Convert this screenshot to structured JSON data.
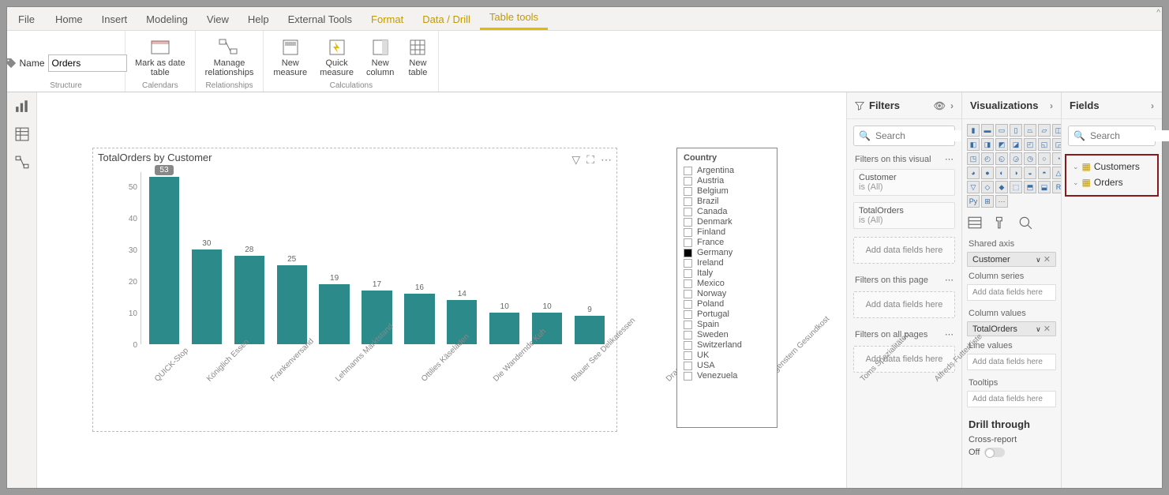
{
  "menu": {
    "file": "File",
    "tabs": [
      "Home",
      "Insert",
      "Modeling",
      "View",
      "Help",
      "External Tools",
      "Format",
      "Data / Drill",
      "Table tools"
    ]
  },
  "ribbon": {
    "name_label": "Name",
    "name_value": "Orders",
    "structure_group": "Structure",
    "calendars_group": "Calendars",
    "relationships_group": "Relationships",
    "calculations_group": "Calculations",
    "mark_date": "Mark as date\ntable",
    "manage_rel": "Manage\nrelationships",
    "new_measure": "New\nmeasure",
    "quick_measure": "Quick\nmeasure",
    "new_column": "New\ncolumn",
    "new_table": "New\ntable"
  },
  "chart_data": {
    "type": "bar",
    "title": "TotalOrders by Customer",
    "ylim": [
      0,
      55
    ],
    "yticks": [
      0,
      10,
      20,
      30,
      40,
      50
    ],
    "categories": [
      "QUICK-Stop",
      "Königlich Essen",
      "Frankenversand",
      "Lehmanns Marktstand",
      "Ottilies Käseladen",
      "Die Wandernde Kuh",
      "Blauer See Delikatessen",
      "Drachenblut Delikatessen",
      "Morgenstern Gesundkost",
      "Toms Spezialitäten",
      "Alfreds Futterkiste"
    ],
    "values": [
      53,
      30,
      28,
      25,
      19,
      17,
      16,
      14,
      10,
      10,
      9
    ]
  },
  "slicer": {
    "title": "Country",
    "items": [
      "Argentina",
      "Austria",
      "Belgium",
      "Brazil",
      "Canada",
      "Denmark",
      "Finland",
      "France",
      "Germany",
      "Ireland",
      "Italy",
      "Mexico",
      "Norway",
      "Poland",
      "Portugal",
      "Spain",
      "Sweden",
      "Switzerland",
      "UK",
      "USA",
      "Venezuela"
    ],
    "selected": "Germany"
  },
  "filters": {
    "header": "Filters",
    "search_placeholder": "Search",
    "on_visual": "Filters on this visual",
    "card1_title": "Customer",
    "card1_sub": "is (All)",
    "card2_title": "TotalOrders",
    "card2_sub": "is (All)",
    "add_here": "Add data fields here",
    "on_page": "Filters on this page",
    "on_all": "Filters on all pages"
  },
  "viz": {
    "header": "Visualizations",
    "shared_axis": "Shared axis",
    "customer_pill": "Customer",
    "column_series": "Column series",
    "column_values": "Column values",
    "totalorders_pill": "TotalOrders",
    "line_values": "Line values",
    "tooltips": "Tooltips",
    "add_here": "Add data fields here",
    "drill": "Drill through",
    "cross": "Cross-report",
    "off": "Off"
  },
  "fields": {
    "header": "Fields",
    "search_placeholder": "Search",
    "tables": [
      "Customers",
      "Orders"
    ]
  }
}
